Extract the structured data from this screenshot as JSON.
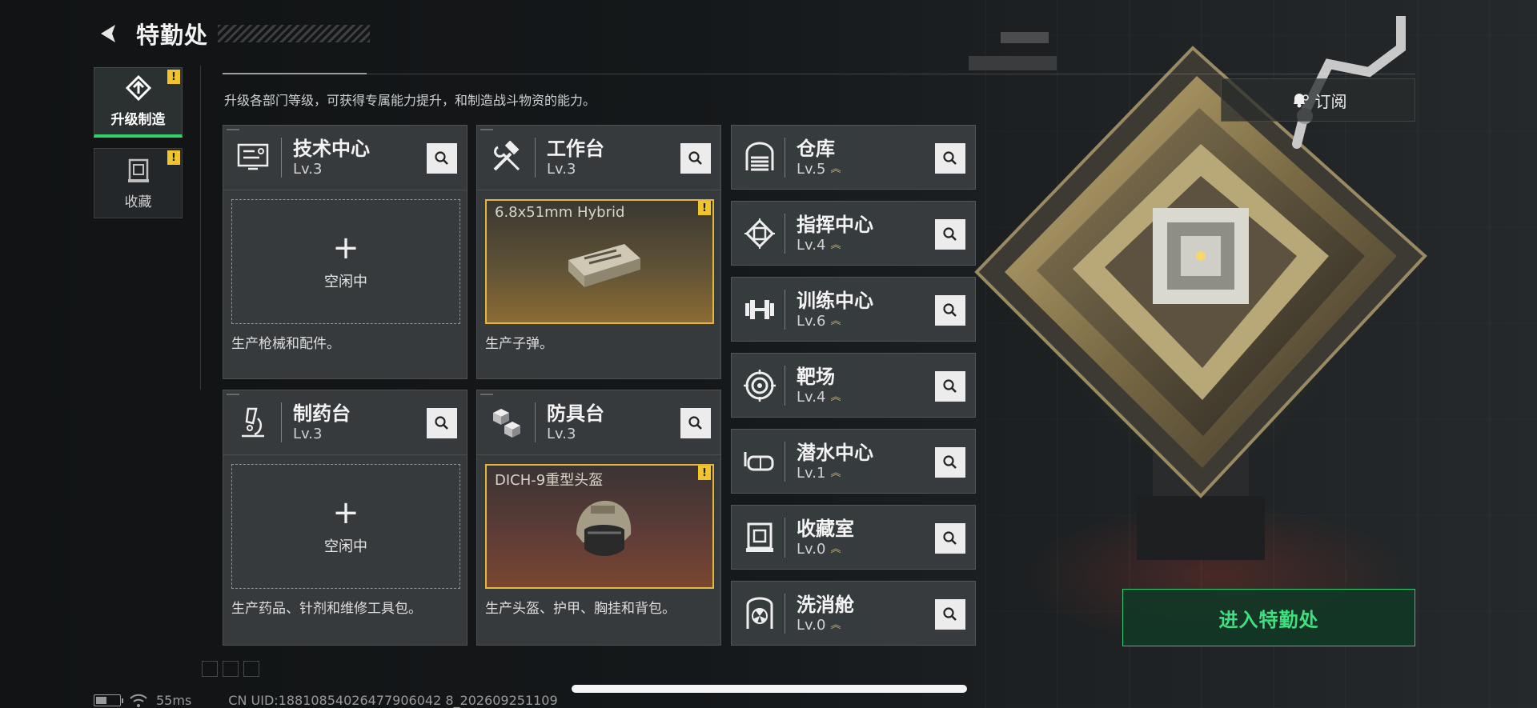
{
  "header": {
    "title": "特勤处"
  },
  "subtitle": "升级各部门等级，可获得专属能力提升，和制造战斗物资的能力。",
  "side_tabs": [
    {
      "label": "升级制造",
      "badge": "!"
    },
    {
      "label": "收藏",
      "badge": "!"
    }
  ],
  "stations": [
    {
      "name": "技术中心",
      "level": "Lv.3",
      "idle": "空闲中",
      "plus": "+",
      "desc": "生产枪械和配件。"
    },
    {
      "name": "工作台",
      "level": "Lv.3",
      "item": "6.8x51mm Hybrid",
      "badge": "!",
      "desc": "生产子弹。"
    },
    {
      "name": "制药台",
      "level": "Lv.3",
      "idle": "空闲中",
      "plus": "+",
      "desc": "生产药品、针剂和维修工具包。"
    },
    {
      "name": "防具台",
      "level": "Lv.3",
      "item": "DICH-9重型头盔",
      "badge": "!",
      "desc": "生产头盔、护甲、胸挂和背包。"
    }
  ],
  "rows": [
    {
      "name": "仓库",
      "level": "Lv.5"
    },
    {
      "name": "指挥中心",
      "level": "Lv.4"
    },
    {
      "name": "训练中心",
      "level": "Lv.6"
    },
    {
      "name": "靶场",
      "level": "Lv.4"
    },
    {
      "name": "潜水中心",
      "level": "Lv.1"
    },
    {
      "name": "收藏室",
      "level": "Lv.0"
    },
    {
      "name": "洗消舱",
      "level": "Lv.0"
    }
  ],
  "buttons": {
    "subscribe": "订阅",
    "enter": "进入特勤处"
  },
  "footer": {
    "ping": "55ms",
    "uid": "CN UID:18810854026477906042 8_202609251109",
    "battery_level": 0.45
  },
  "colors": {
    "accent": "#2fd36a",
    "warning": "#f0c52c",
    "item_border": "#e4b63c"
  }
}
